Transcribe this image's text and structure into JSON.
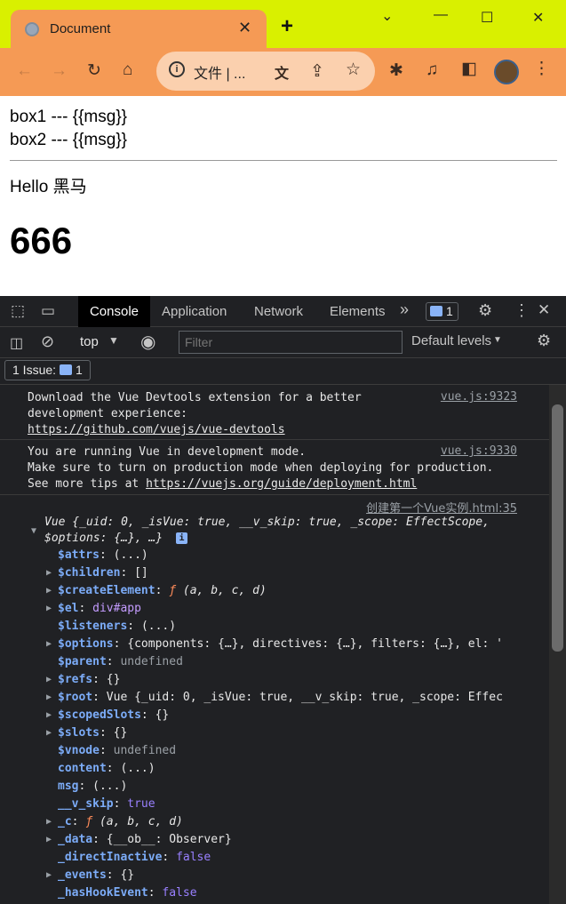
{
  "browser": {
    "tab_title": "Document",
    "tab_close": "✕",
    "new_tab": "+",
    "win_min": "⌄",
    "win_minimize": "—",
    "win_max": "☐",
    "win_close": "✕",
    "omnibox_info": "i",
    "omnibox_text": "文件 | ..."
  },
  "page": {
    "line1": "box1 --- {{msg}}",
    "line2": "box2 --- {{msg}}",
    "hello": "Hello 黑马",
    "heading": "666"
  },
  "devtools": {
    "tabs": [
      "Console",
      "Application",
      "Network",
      "Elements"
    ],
    "more_tabs": "»",
    "issues_count": "1",
    "context": "top",
    "filter_placeholder": "Filter",
    "levels": "Default levels",
    "issue_label": "1 Issue:",
    "issue_count": "1"
  },
  "console": {
    "msg1": {
      "line1": "Download the Vue Devtools extension for a better",
      "line2": "development experience:",
      "link": "https://github.com/vuejs/vue-devtools",
      "source": "vue.js:9323"
    },
    "msg2": {
      "line1": "You are running Vue in development mode.",
      "line2": "Make sure to turn on production mode when deploying for production.",
      "line3_prefix": "See more tips at ",
      "link": "https://vuejs.org/guide/deployment.html",
      "source": "vue.js:9330"
    },
    "obj": {
      "source": "创建第一个Vue实例.html:35",
      "summary1": "Vue {_uid: 0, _isVue: true, __v_skip: true, _scope: EffectScope,",
      "summary2": "$options: {…}, …}",
      "info_badge": "i"
    },
    "props": [
      {
        "key": "$attrs",
        "sep": ": ",
        "value": "(...)",
        "expandable": false,
        "vclass": ""
      },
      {
        "key": "$children",
        "sep": ": ",
        "value": "[]",
        "expandable": true,
        "vclass": ""
      },
      {
        "key": "$createElement",
        "sep": ": ",
        "value": "ƒ (a, b, c, d)",
        "expandable": true,
        "vclass": "fn"
      },
      {
        "key": "$el",
        "sep": ": ",
        "value": "div#app",
        "expandable": true,
        "vclass": "el"
      },
      {
        "key": "$listeners",
        "sep": ": ",
        "value": "(...)",
        "expandable": false,
        "vclass": ""
      },
      {
        "key": "$options",
        "sep": ": ",
        "value": "{components: {…}, directives: {…}, filters: {…}, el: '",
        "expandable": true,
        "vclass": ""
      },
      {
        "key": "$parent",
        "sep": ": ",
        "value": "undefined",
        "expandable": false,
        "vclass": "dim"
      },
      {
        "key": "$refs",
        "sep": ": ",
        "value": "{}",
        "expandable": true,
        "vclass": ""
      },
      {
        "key": "$root",
        "sep": ": ",
        "value": "Vue {_uid: 0, _isVue: true, __v_skip: true, _scope: Effec",
        "expandable": true,
        "vclass": ""
      },
      {
        "key": "$scopedSlots",
        "sep": ": ",
        "value": "{}",
        "expandable": true,
        "vclass": ""
      },
      {
        "key": "$slots",
        "sep": ": ",
        "value": "{}",
        "expandable": true,
        "vclass": ""
      },
      {
        "key": "$vnode",
        "sep": ": ",
        "value": "undefined",
        "expandable": false,
        "vclass": "dim"
      },
      {
        "key": "content",
        "sep": ": ",
        "value": "(...)",
        "expandable": false,
        "vclass": ""
      },
      {
        "key": "msg",
        "sep": ": ",
        "value": "(...)",
        "expandable": false,
        "vclass": ""
      },
      {
        "key": "__v_skip",
        "sep": ": ",
        "value": "true",
        "expandable": false,
        "vclass": "kw"
      },
      {
        "key": "_c",
        "sep": ": ",
        "value": "ƒ (a, b, c, d)",
        "expandable": true,
        "vclass": "fn"
      },
      {
        "key": "_data",
        "sep": ": ",
        "value": "{__ob__: Observer}",
        "expandable": true,
        "vclass": ""
      },
      {
        "key": "_directInactive",
        "sep": ": ",
        "value": "false",
        "expandable": false,
        "vclass": "kw"
      },
      {
        "key": "_events",
        "sep": ": ",
        "value": "{}",
        "expandable": true,
        "vclass": ""
      },
      {
        "key": "_hasHookEvent",
        "sep": ": ",
        "value": "false",
        "expandable": false,
        "vclass": "kw"
      }
    ]
  },
  "colors": {
    "titlebar": "#d9f000",
    "tab": "#f59a55",
    "devtools_bg": "#202124",
    "prop_key": "#7cacf8",
    "keyword": "#9980ff"
  },
  "icons": [
    "globe-icon",
    "back-arrow-icon",
    "forward-arrow-icon",
    "reload-icon",
    "home-icon",
    "translate-icon",
    "share-icon",
    "star-icon",
    "extensions-icon",
    "media-icon",
    "sidepanel-icon",
    "kebab-menu-icon",
    "inspect-icon",
    "device-icon",
    "gear-icon",
    "close-icon",
    "sidebar-toggle-icon",
    "clear-icon",
    "eye-icon"
  ]
}
